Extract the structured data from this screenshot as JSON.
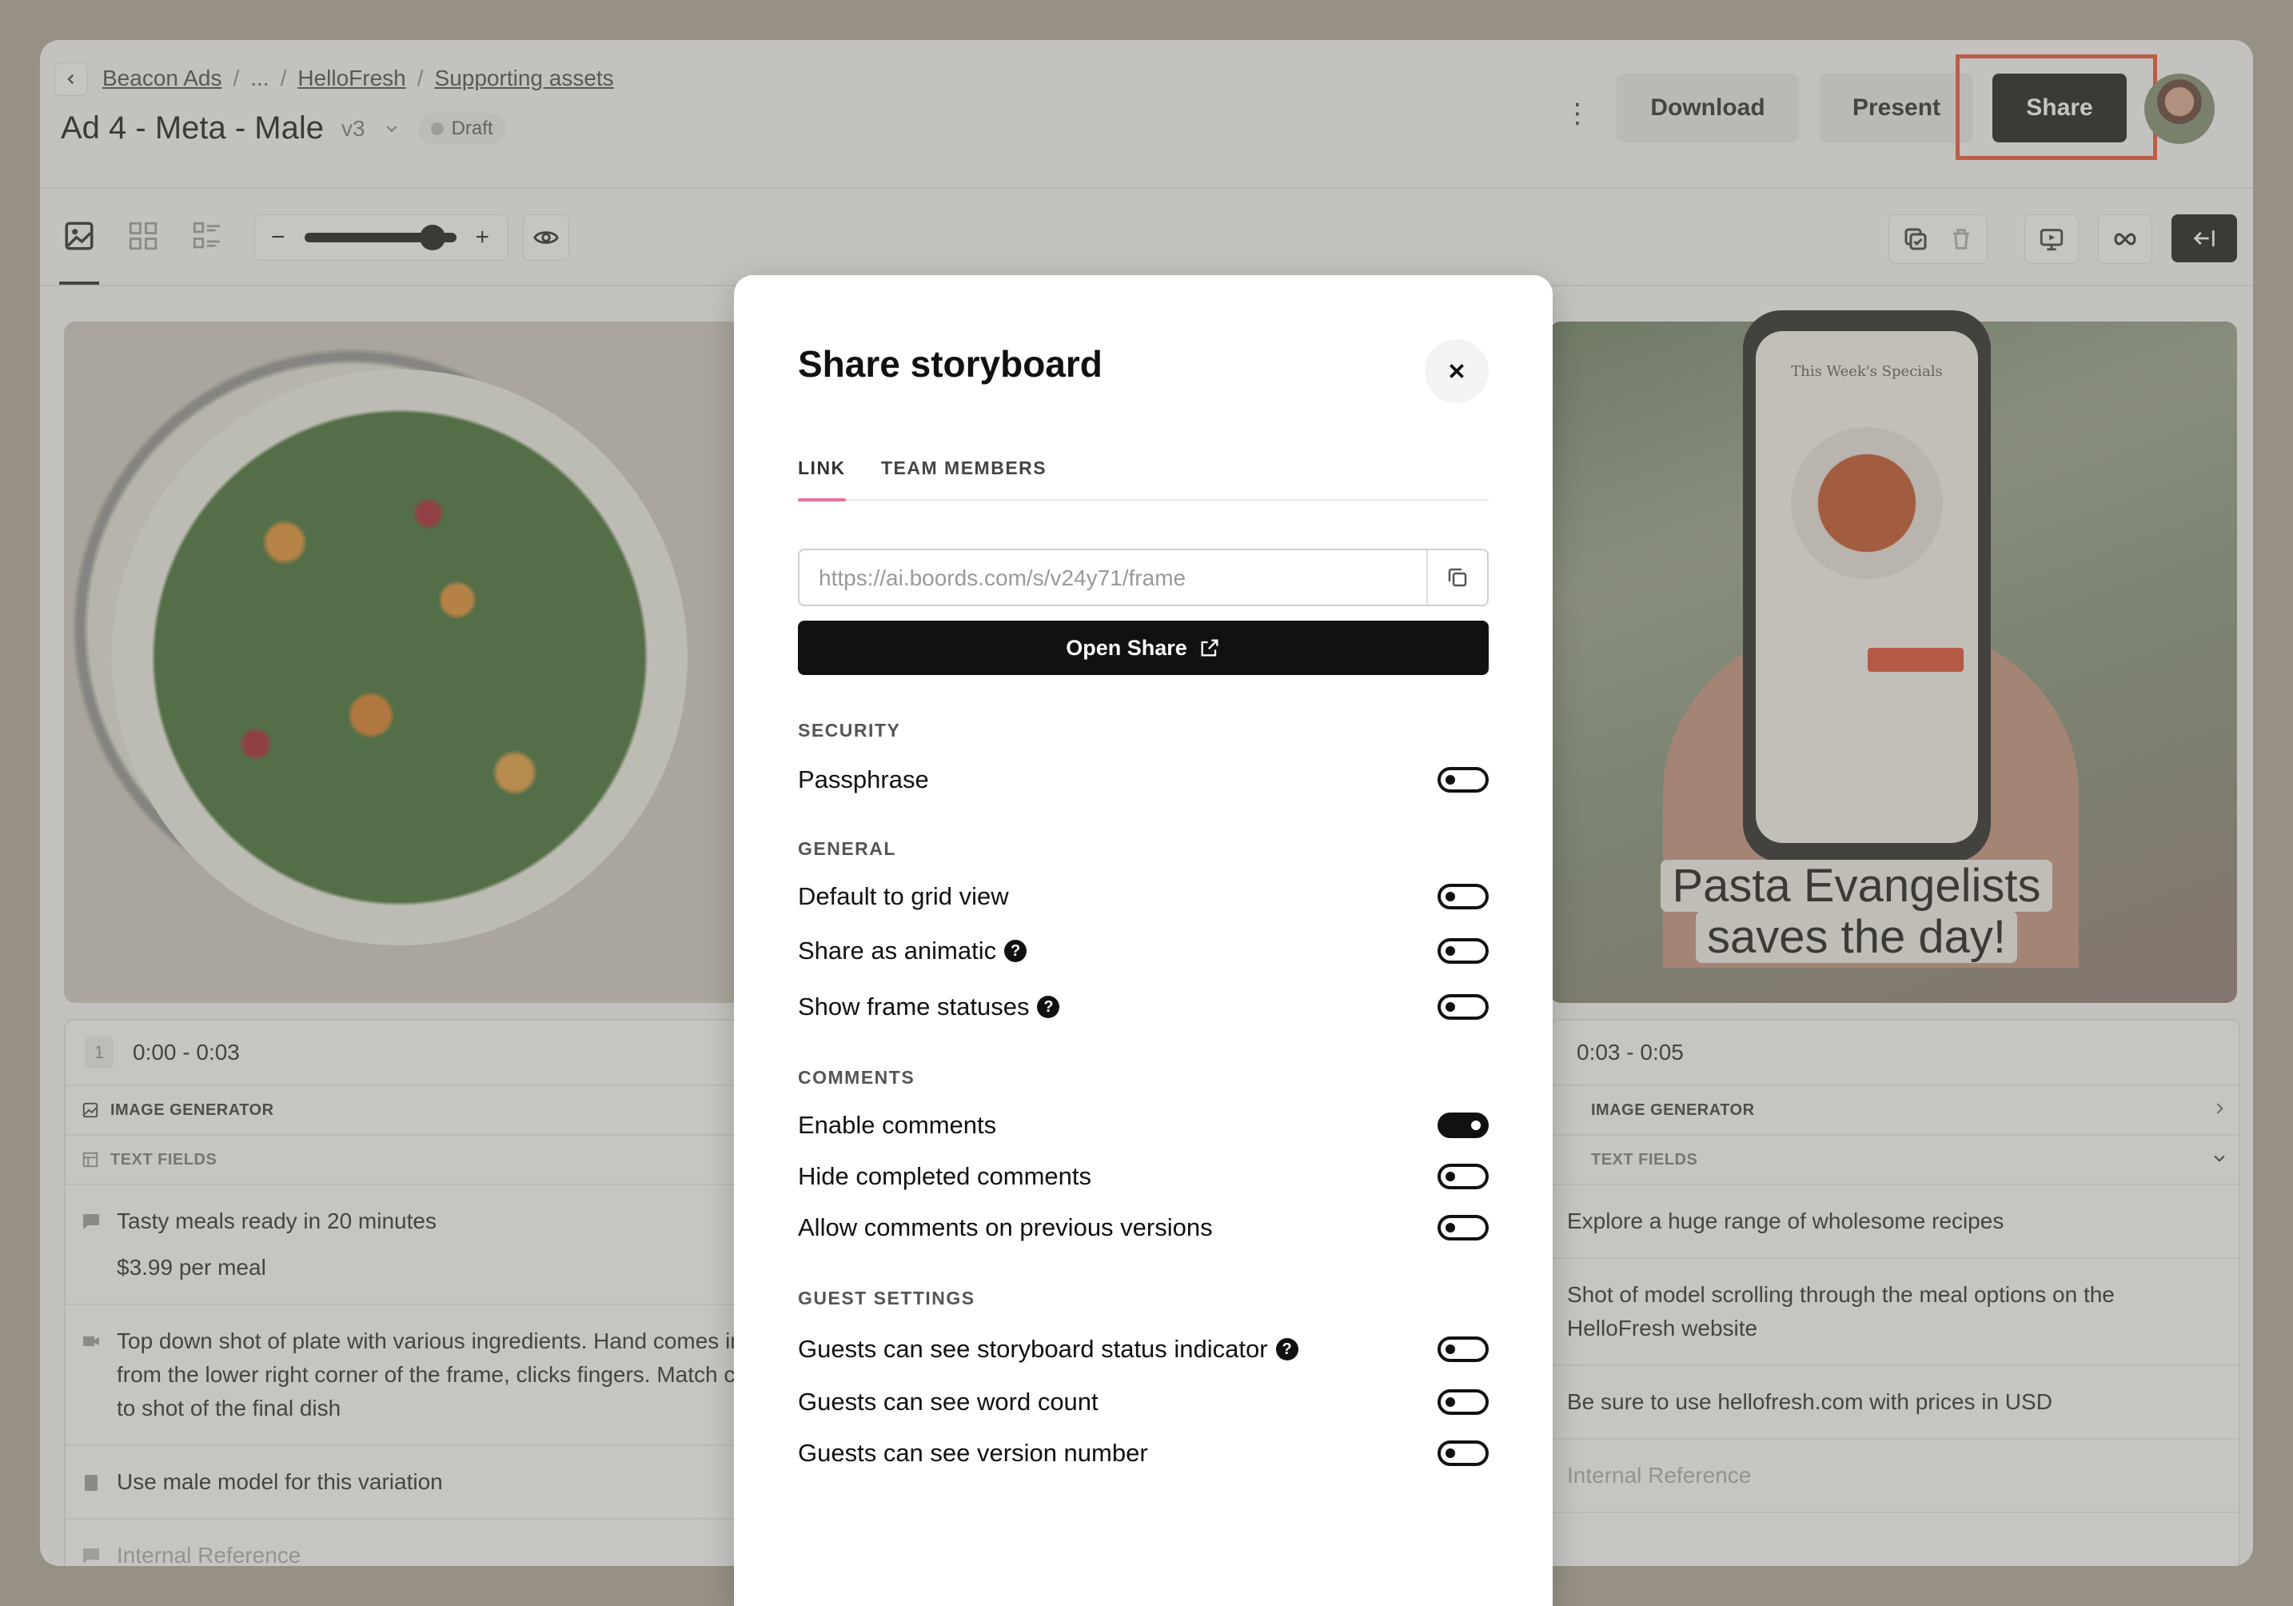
{
  "header": {
    "breadcrumb": [
      "Beacon Ads",
      "...",
      "HelloFresh",
      "Supporting assets"
    ],
    "title": "Ad 4 - Meta - Male",
    "version": "v3",
    "status": "Draft",
    "download_label": "Download",
    "present_label": "Present",
    "share_label": "Share"
  },
  "frames": [
    {
      "number": "1",
      "time": "0:00 - 0:03",
      "image_generator_label": "IMAGE GENERATOR",
      "text_fields_label": "TEXT FIELDS",
      "fields": [
        [
          "Tasty meals ready in 20 minutes",
          "$3.99 per meal"
        ],
        [
          "Top down shot of plate with various ingredients. Hand comes in from the lower right corner of the frame, clicks fingers. Match cut to shot of the final dish"
        ],
        [
          "Use male model for this variation"
        ]
      ],
      "internal_reference": "Internal Reference"
    },
    {
      "time": "0:03 - 0:05",
      "image_generator_label": "IMAGE GENERATOR",
      "text_fields_label": "TEXT FIELDS",
      "caption": "Pasta Evangelists saves the day!",
      "phone_title": "This Week's Specials",
      "fields": [
        [
          "Explore a huge range of wholesome recipes"
        ],
        [
          "Shot of model scrolling through the meal options on the HelloFresh website"
        ],
        [
          "Be sure to use hellofresh.com with prices in USD"
        ]
      ],
      "internal_reference": "Internal Reference"
    }
  ],
  "modal": {
    "title": "Share storyboard",
    "tabs": [
      "LINK",
      "TEAM MEMBERS"
    ],
    "url_placeholder": "https://ai.boords.com/s/v24y71/frame",
    "open_share_label": "Open Share",
    "sections": {
      "security": "SECURITY",
      "general": "GENERAL",
      "comments": "COMMENTS",
      "guest": "GUEST SETTINGS"
    },
    "options": {
      "passphrase": "Passphrase",
      "grid_view": "Default to grid view",
      "animatic": "Share as animatic",
      "frame_statuses": "Show frame statuses",
      "enable_comments": "Enable comments",
      "hide_completed": "Hide completed comments",
      "allow_previous": "Allow comments on previous versions",
      "guest_status": "Guests can see storyboard status indicator",
      "guest_word_count": "Guests can see word count",
      "guest_version": "Guests can see version number"
    },
    "toggle_states": {
      "passphrase": false,
      "grid_view": false,
      "animatic": false,
      "frame_statuses": false,
      "enable_comments": true,
      "hide_completed": false,
      "allow_previous": false,
      "guest_status": false,
      "guest_word_count": false,
      "guest_version": false
    }
  },
  "colors": {
    "highlight": "#f04a2c",
    "tab_underline": "#e8709a",
    "primary": "#111111"
  }
}
